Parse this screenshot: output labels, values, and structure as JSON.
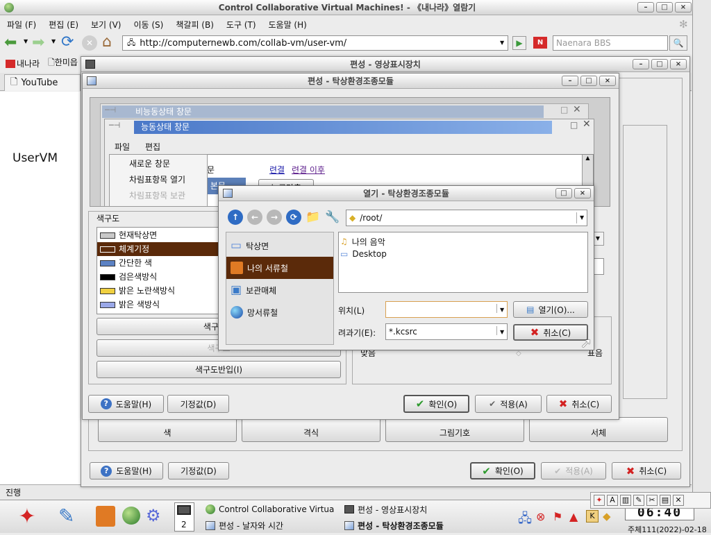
{
  "browser": {
    "title": "Control Collaborative Virtual Machines! - 《내나라》열람기",
    "menu": [
      "파일 (F)",
      "편집 (E)",
      "보기 (V)",
      "이동 (S)",
      "책갈피 (B)",
      "도구 (T)",
      "도움말 (H)"
    ],
    "url": "http://computernewb.com/collab-vm/user-vm/",
    "search_placeholder": "Naenara BBS",
    "bookmarks": [
      "내나라",
      "한미읍"
    ],
    "tab": "YouTube",
    "page_heading": "UserVM",
    "status": "진행"
  },
  "dlg1": {
    "title": "편성 - 영상표시장치",
    "tabs": [
      "색",
      "격식",
      "그림기호",
      "서체"
    ],
    "help": "도움말(H)",
    "defaults": "기정값(D)",
    "ok": "확인(O)",
    "apply": "적용(A)",
    "cancel": "취소(C)"
  },
  "dlg2": {
    "title": "편성 - 탁상환경조종모듈",
    "preview": {
      "inactive_title": "비능동상태 창문",
      "active_title": "능동상태 창문",
      "menu": [
        "파일",
        "편집"
      ],
      "dropdown": [
        "새로운 창문",
        "차림표항목 열기",
        "차림표항목 보관"
      ],
      "text_frag": "문",
      "link1": "련결",
      "link2": "련결 이후",
      "sel_frag": "된 본문",
      "btn_frag": "누르단추"
    },
    "schemes_label": "색구도",
    "schemes": [
      {
        "name": "현재탁상면",
        "color": "#c9c9c9"
      },
      {
        "name": "체계기정",
        "color": "#5b2a0a"
      },
      {
        "name": "간단한 색",
        "color": "#5c82c4"
      },
      {
        "name": "검은색방식",
        "color": "#000000"
      },
      {
        "name": "밝은 노란색방식",
        "color": "#f0d040"
      },
      {
        "name": "밝은 색방식",
        "color": "#9aa8e8"
      }
    ],
    "scheme_btns": [
      "색구도보",
      "색구도",
      "색구도반입(I)"
    ],
    "right_frag": [
      "맞음",
      "표음"
    ],
    "help": "도움말(H)",
    "defaults": "기정값(D)",
    "ok": "확인(O)",
    "apply": "적용(A)",
    "cancel": "취소(C)"
  },
  "open": {
    "title": "열기 - 탁상환경조종모듈",
    "path": "/root/",
    "places": [
      "탁상면",
      "나의 서류철",
      "보관매체",
      "망서류철"
    ],
    "files": [
      "나의 음악",
      "Desktop"
    ],
    "location_label": "위치(L)",
    "filter_label": "려과기(E):",
    "filter": "*.kcsrc",
    "open_btn": "열기(O)...",
    "cancel_btn": "취소(C)"
  },
  "taskbar": {
    "desk_num": "2",
    "tasks": [
      "Control Collaborative Virtua",
      "편성 - 영상표시장치",
      "편성 - 날자와 시간",
      "편성 - 탁상환경조종모듈"
    ],
    "clock": "06:40",
    "date": "주체111(2022)-02-18"
  }
}
